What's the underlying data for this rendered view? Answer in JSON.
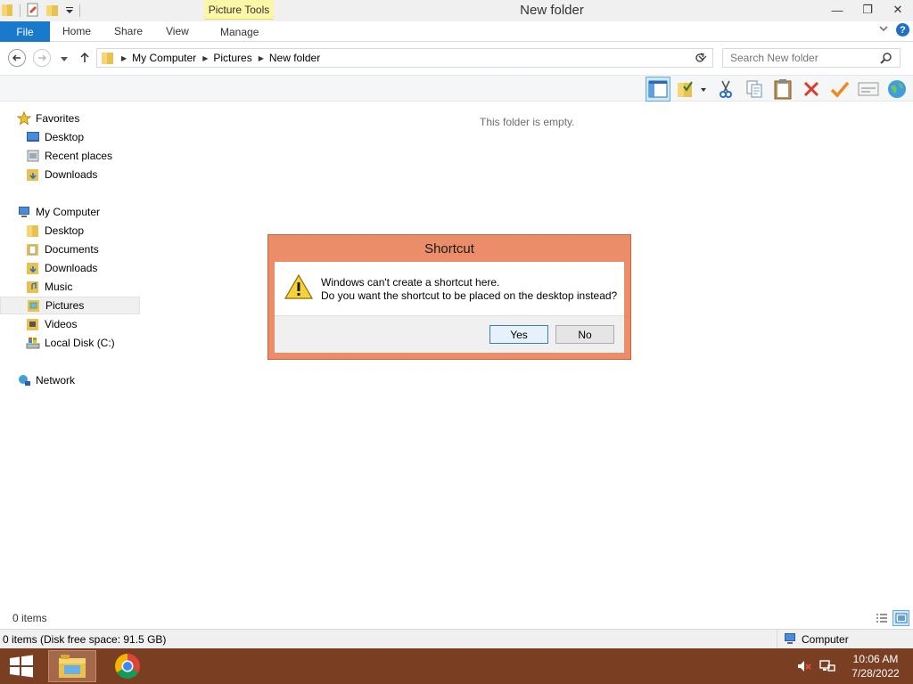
{
  "window": {
    "title": "New folder",
    "contextual_tab": "Picture Tools",
    "controls": {
      "minimize": "—",
      "restore": "❐",
      "close": "✕"
    }
  },
  "ribbon": {
    "tabs": [
      "File",
      "Home",
      "Share",
      "View",
      "Manage"
    ]
  },
  "address": {
    "breadcrumbs": [
      "My Computer",
      "Pictures",
      "New folder"
    ],
    "search_placeholder": "Search New folder"
  },
  "nav": {
    "favorites": {
      "label": "Favorites",
      "items": [
        "Desktop",
        "Recent places",
        "Downloads"
      ]
    },
    "computer": {
      "label": "My Computer",
      "items": [
        "Desktop",
        "Documents",
        "Downloads",
        "Music",
        "Pictures",
        "Videos",
        "Local Disk (C:)"
      ]
    },
    "network": {
      "label": "Network"
    },
    "selected": "Pictures"
  },
  "content": {
    "empty_message": "This folder is empty."
  },
  "status": {
    "items_count": "0 items",
    "details": "0 items (Disk free space: 91.5 GB)",
    "location": "Computer"
  },
  "dialog": {
    "title": "Shortcut",
    "line1": "Windows can't create a shortcut here.",
    "line2": "Do you want the shortcut to be placed on the desktop instead?",
    "yes_label": "Yes",
    "no_label": "No"
  },
  "taskbar": {
    "time": "10:06 AM",
    "date": "7/28/2022"
  },
  "colors": {
    "dialog_frame": "#ec8d69",
    "taskbar": "#7a3e23",
    "file_tab": "#1979ca",
    "contextual_tab": "#fbf7a6"
  }
}
